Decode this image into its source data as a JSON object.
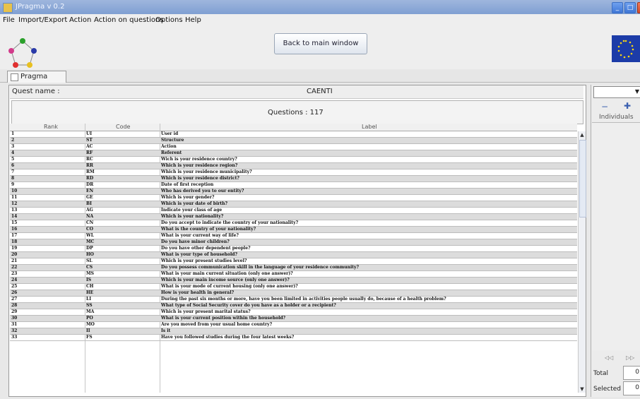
{
  "window": {
    "title": "JPragma v 0.2"
  },
  "menu": [
    "File",
    "Import/Export",
    "Action",
    "Action on questions",
    "Options",
    "Help"
  ],
  "toolbar": {
    "back_label": "Back to main window"
  },
  "tab": {
    "label": "Pragma"
  },
  "quest": {
    "name_label": "Quest name :",
    "name_value": "CAENTI",
    "questions_label": "Questions : 117"
  },
  "table": {
    "headers": [
      "Rank",
      "Code",
      "Label"
    ],
    "rows": [
      [
        "1",
        "UI",
        "User id"
      ],
      [
        "2",
        "ST",
        "Structure"
      ],
      [
        "3",
        "AC",
        "Action"
      ],
      [
        "4",
        "RF",
        "Referent"
      ],
      [
        "5",
        "RC",
        "Wich is your residence country?"
      ],
      [
        "6",
        "RR",
        "Which is your residence region?"
      ],
      [
        "7",
        "RM",
        "Which is your residence municipality?"
      ],
      [
        "8",
        "RD",
        "Which is your residence district?"
      ],
      [
        "9",
        "DR",
        "Date of first reception"
      ],
      [
        "10",
        "EN",
        "Who has derived you to our entity?"
      ],
      [
        "11",
        "GE",
        "Which is your gender?"
      ],
      [
        "12",
        "BI",
        "Which is your date of birth?"
      ],
      [
        "13",
        "AG",
        "Indicate your class of age"
      ],
      [
        "14",
        "NA",
        "Which is your nationality?"
      ],
      [
        "15",
        "CN",
        "Do you accept to indicate the country of your nationality?"
      ],
      [
        "16",
        "CO",
        "What is the country of your nationality?"
      ],
      [
        "17",
        "WL",
        "What is your current way of life?"
      ],
      [
        "18",
        "MC",
        "Do you have minor children?"
      ],
      [
        "19",
        "DP",
        "Do you have other dependent people?"
      ],
      [
        "20",
        "HO",
        "What is your type of household?"
      ],
      [
        "21",
        "SL",
        "Which is your present studies level?"
      ],
      [
        "22",
        "CS",
        "Do you possess communication skill in the language of your residence community?"
      ],
      [
        "23",
        "MS",
        "What is your main current situation (only one answer)?"
      ],
      [
        "24",
        "IS",
        "Which is your main income source (only one answer)?"
      ],
      [
        "25",
        "CH",
        "What is your mode of current housing (only one answer)?"
      ],
      [
        "26",
        "HE",
        "How is your health in general?"
      ],
      [
        "27",
        "LI",
        "During the past six months or more, have you been limited in activities people usually do, because of a health problem?"
      ],
      [
        "28",
        "SS",
        "What type of Social Security cover do you have as a holder or a recipient?"
      ],
      [
        "29",
        "MA",
        "Which is your present marital status?"
      ],
      [
        "30",
        "PO",
        "What is your current position within the household?"
      ],
      [
        "31",
        "MO",
        "Are you moved from your usual home country?"
      ],
      [
        "32",
        "II",
        "Is it"
      ],
      [
        "33",
        "FS",
        "Have you followed studies during the four latest weeks?"
      ]
    ]
  },
  "right_panel": {
    "individuals_label": "Individuals",
    "total_label": "Total",
    "total_value": "0",
    "selected_label": "Selected",
    "selected_value": "0"
  }
}
